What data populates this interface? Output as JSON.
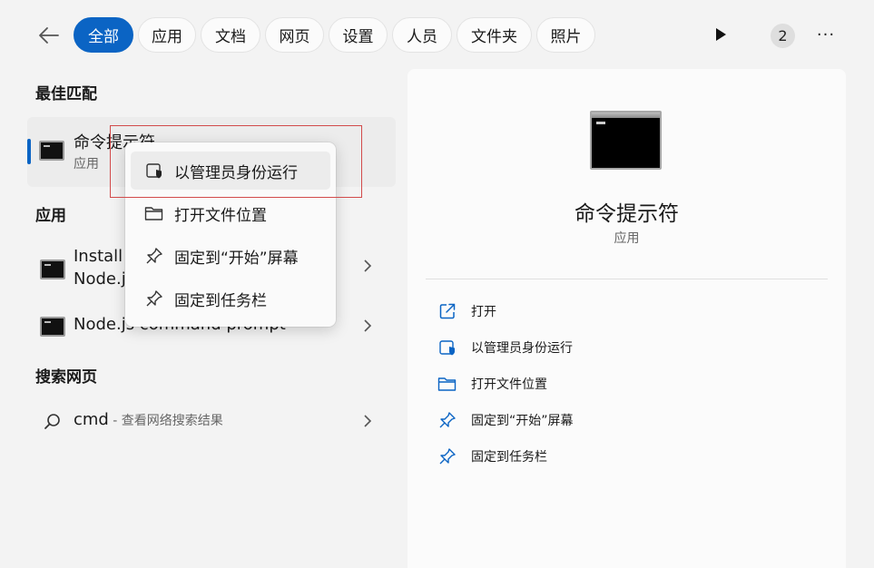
{
  "filters": {
    "tabs": [
      {
        "label": "全部",
        "active": true
      },
      {
        "label": "应用"
      },
      {
        "label": "文档"
      },
      {
        "label": "网页"
      },
      {
        "label": "设置"
      },
      {
        "label": "人员"
      },
      {
        "label": "文件夹"
      },
      {
        "label": "照片"
      }
    ],
    "badge_count": "2",
    "more_label": "···"
  },
  "best_match": {
    "heading": "最佳匹配",
    "title": "命令提示符",
    "subtitle": "应用"
  },
  "apps_section": {
    "heading": "应用",
    "items": [
      {
        "title_line1": "Install Additional Tools for",
        "title_line2": "Node.js"
      },
      {
        "title": "Node.js command prompt"
      }
    ]
  },
  "web_section": {
    "heading": "搜索网页",
    "query": "cmd",
    "hint": " - 查看网络搜索结果"
  },
  "context_menu": {
    "items": [
      {
        "label": "以管理员身份运行"
      },
      {
        "label": "打开文件位置"
      },
      {
        "label": "固定到“开始”屏幕"
      },
      {
        "label": "固定到任务栏"
      }
    ]
  },
  "preview": {
    "title": "命令提示符",
    "subtitle": "应用",
    "actions": [
      {
        "label": "打开",
        "icon": "open-external-icon"
      },
      {
        "label": "以管理员身份运行",
        "icon": "shield-run-icon"
      },
      {
        "label": "打开文件位置",
        "icon": "folder-icon"
      },
      {
        "label": "固定到“开始”屏幕",
        "icon": "pin-icon"
      },
      {
        "label": "固定到任务栏",
        "icon": "pin-icon"
      }
    ]
  },
  "colors": {
    "accent": "#0b64c4",
    "highlight_box": "#d24b4b"
  }
}
